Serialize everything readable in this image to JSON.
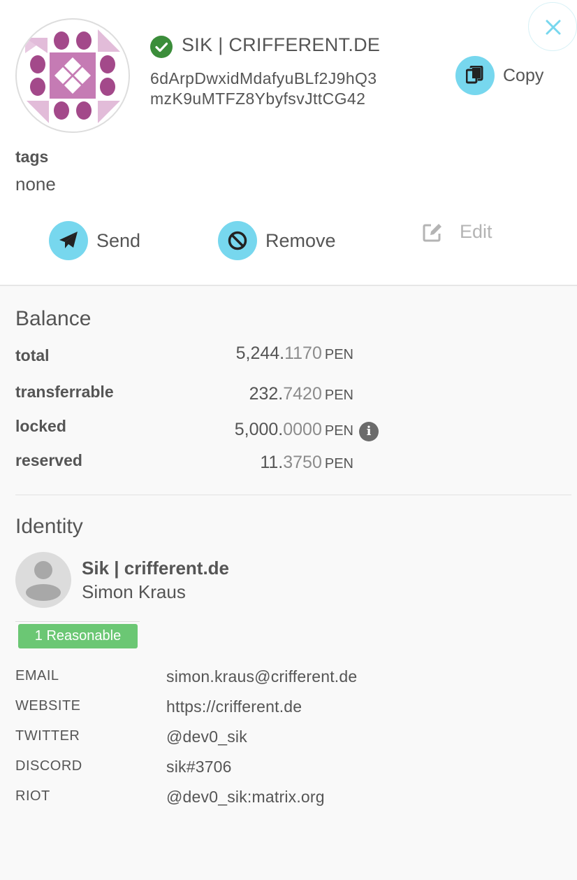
{
  "account": {
    "name": "SIK | CRIFFERENT.DE",
    "address_line1": "6dArpDwxidMdafyuBLf2J9hQ3",
    "address_line2": "mzK9uMTFZ8YbyfsvJttCG42",
    "copy_label": "Copy"
  },
  "tags": {
    "label": "tags",
    "value": "none"
  },
  "actions": {
    "send": "Send",
    "remove": "Remove",
    "edit": "Edit"
  },
  "balance": {
    "title": "Balance",
    "rows": [
      {
        "label": "total",
        "int": "5,244.",
        "frac": "1170",
        "unit": "PEN"
      },
      {
        "label": "transferrable",
        "int": "232.",
        "frac": "7420",
        "unit": "PEN"
      },
      {
        "label": "locked",
        "int": "5,000.",
        "frac": "0000",
        "unit": "PEN"
      },
      {
        "label": "reserved",
        "int": "11.",
        "frac": "3750",
        "unit": "PEN"
      }
    ]
  },
  "identity": {
    "title": "Identity",
    "display": "Sik | crifferent.de",
    "legal": "Simon Kraus",
    "judgement": "1 Reasonable",
    "fields": [
      {
        "label": "EMAIL",
        "value": "simon.kraus@crifferent.de"
      },
      {
        "label": "WEBSITE",
        "value": "https://crifferent.de"
      },
      {
        "label": "TWITTER",
        "value": "@dev0_sik"
      },
      {
        "label": "DISCORD",
        "value": "sik#3706"
      },
      {
        "label": "RIOT",
        "value": "@dev0_sik:matrix.org"
      }
    ]
  },
  "colors": {
    "accent": "#77d7ee",
    "verified": "#3b8d3a",
    "judgement": "#6bc774",
    "identicon_dark": "#a3498a",
    "identicon_mid": "#c57bb4",
    "identicon_light": "#e2bcd9"
  }
}
